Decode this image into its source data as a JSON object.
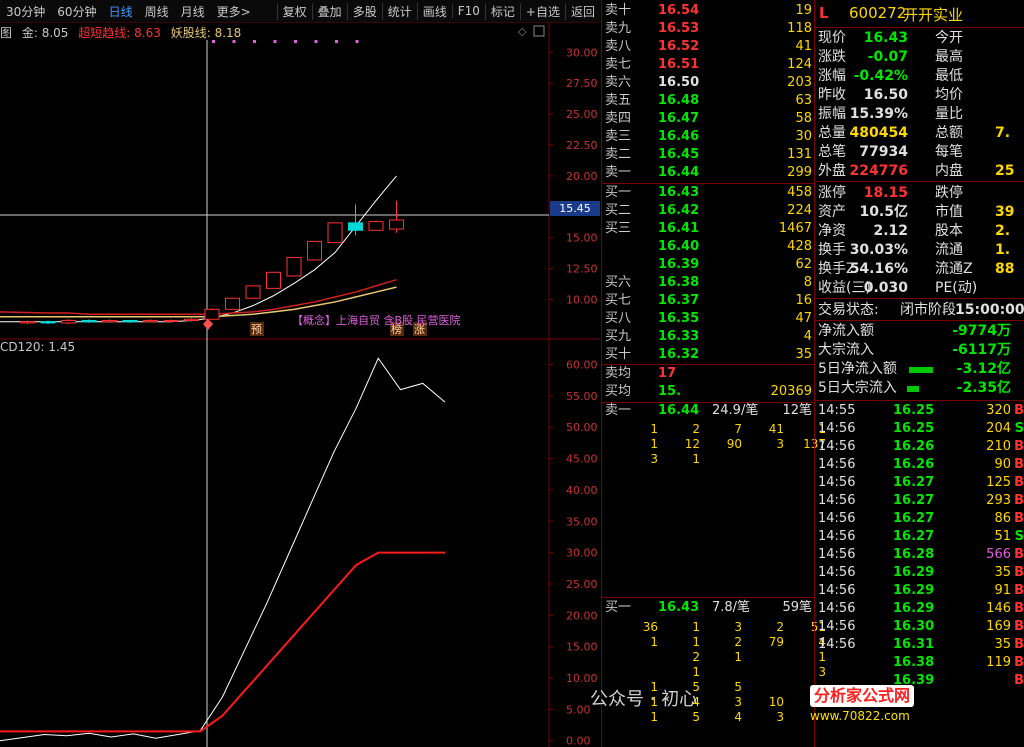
{
  "toolbar": {
    "tabs": [
      "30分钟",
      "60分钟",
      "日线",
      "周线",
      "月线",
      "更多>"
    ],
    "active_tab": "日线",
    "buttons": [
      "复权",
      "叠加",
      "多股",
      "统计",
      "画线",
      "F10",
      "标记",
      "+自选",
      "返回"
    ]
  },
  "indicators": {
    "prefix": "图",
    "gold_label": "金:",
    "gold_value": "8.05",
    "super_label": "超短趋线:",
    "super_value": "8.63",
    "demon_label": "妖股线:",
    "demon_value": "8.18"
  },
  "macd_label": "CD120: 1.45",
  "concept_text": "【概念】上海自贸 含B股 民营医院",
  "markers": [
    "预",
    "榜",
    "涨"
  ],
  "current_price_tag": "15.45",
  "colors": {
    "up": "#ff3232",
    "down": "#00e600",
    "grid": "#7a0000",
    "accent": "#3a9cff"
  },
  "chart_data": [
    {
      "type": "candlestick",
      "y_ticks": [
        "30.00",
        "27.50",
        "25.00",
        "22.50",
        "20.00",
        "17.50",
        "15.00",
        "12.50",
        "10.00"
      ],
      "ylim": [
        8.5,
        31
      ],
      "candles": [
        {
          "o": 8.1,
          "c": 8.2,
          "h": 8.3,
          "l": 8.0
        },
        {
          "o": 8.2,
          "c": 8.1,
          "h": 8.3,
          "l": 8.0
        },
        {
          "o": 8.1,
          "c": 8.3,
          "h": 8.4,
          "l": 8.0
        },
        {
          "o": 8.3,
          "c": 8.2,
          "h": 8.4,
          "l": 8.1
        },
        {
          "o": 8.2,
          "c": 8.3,
          "h": 8.4,
          "l": 8.1
        },
        {
          "o": 8.3,
          "c": 8.2,
          "h": 8.3,
          "l": 8.1
        },
        {
          "o": 8.2,
          "c": 8.3,
          "h": 8.4,
          "l": 8.2
        },
        {
          "o": 8.3,
          "c": 8.3,
          "h": 8.4,
          "l": 8.2
        },
        {
          "o": 8.3,
          "c": 8.4,
          "h": 8.5,
          "l": 8.2
        },
        {
          "o": 8.4,
          "c": 9.2,
          "h": 9.3,
          "l": 8.4
        },
        {
          "o": 9.2,
          "c": 10.1,
          "h": 10.1,
          "l": 9.2
        },
        {
          "o": 10.1,
          "c": 11.1,
          "h": 11.1,
          "l": 10.1
        },
        {
          "o": 10.9,
          "c": 12.2,
          "h": 12.2,
          "l": 10.9
        },
        {
          "o": 11.9,
          "c": 13.4,
          "h": 13.4,
          "l": 11.9
        },
        {
          "o": 13.2,
          "c": 14.7,
          "h": 14.7,
          "l": 13.2
        },
        {
          "o": 14.6,
          "c": 16.2,
          "h": 16.2,
          "l": 14.6
        },
        {
          "o": 16.2,
          "c": 15.6,
          "h": 17.7,
          "l": 15.2
        },
        {
          "o": 15.6,
          "c": 16.3,
          "h": 16.4,
          "l": 15.6
        },
        {
          "o": 15.7,
          "c": 16.43,
          "h": 18.0,
          "l": 15.4
        }
      ],
      "ma": [
        {
          "name": "",
          "color": "#ffffff",
          "values": [
            8.2,
            8.2,
            8.2,
            8.2,
            8.2,
            8.2,
            8.2,
            8.2,
            8.3,
            8.5,
            8.9,
            9.5,
            10.3,
            11.3,
            12.4,
            13.8,
            15.9,
            18.0,
            20.0
          ]
        },
        {
          "name": "",
          "color": "#d02020",
          "values": [
            9.0,
            8.9,
            8.9,
            8.8,
            8.8,
            8.8,
            8.8,
            8.8,
            8.8,
            8.8,
            8.9,
            9.0,
            9.2,
            9.5,
            9.8,
            10.2,
            10.6,
            11.1,
            11.6
          ]
        },
        {
          "name": "",
          "color": "#e8c870",
          "values": [
            8.6,
            8.6,
            8.6,
            8.6,
            8.6,
            8.6,
            8.6,
            8.6,
            8.6,
            8.6,
            8.7,
            8.8,
            9.0,
            9.2,
            9.5,
            9.8,
            10.2,
            10.6,
            11.0
          ]
        }
      ]
    },
    {
      "type": "line",
      "y_ticks": [
        "60.00",
        "55.00",
        "50.00",
        "45.00",
        "40.00",
        "35.00",
        "30.00",
        "25.00",
        "20.00",
        "15.00",
        "10.00",
        "5.00",
        "0.00"
      ],
      "ylim": [
        -1,
        62
      ],
      "series": [
        {
          "name": "",
          "color": "#ffffff",
          "values": [
            0,
            0.5,
            1,
            0.8,
            1.2,
            0.6,
            1.1,
            0.4,
            1,
            1.6,
            7,
            14.5,
            22,
            30,
            38,
            46,
            53,
            61,
            56,
            57,
            54
          ]
        },
        {
          "name": "",
          "color": "#ff1a1a",
          "values": [
            1.5,
            1.5,
            1.5,
            1.5,
            1.5,
            1.5,
            1.5,
            1.5,
            1.5,
            1.5,
            4,
            8,
            12,
            16,
            20,
            24,
            28,
            30,
            30,
            30,
            30
          ]
        }
      ]
    }
  ],
  "order_book": {
    "asks": [
      {
        "label": "卖十",
        "price": "16.54",
        "vol": "19"
      },
      {
        "label": "卖九",
        "price": "16.53",
        "vol": "118"
      },
      {
        "label": "卖八",
        "price": "16.52",
        "vol": "41"
      },
      {
        "label": "卖七",
        "price": "16.51",
        "vol": "124"
      },
      {
        "label": "卖六",
        "price": "16.50",
        "vol": "203"
      },
      {
        "label": "卖五",
        "price": "16.48",
        "vol": "63"
      },
      {
        "label": "卖四",
        "price": "16.47",
        "vol": "58"
      },
      {
        "label": "卖三",
        "price": "16.46",
        "vol": "30"
      },
      {
        "label": "卖二",
        "price": "16.45",
        "vol": "131"
      },
      {
        "label": "卖一",
        "price": "16.44",
        "vol": "299"
      }
    ],
    "bids": [
      {
        "label": "买一",
        "price": "16.43",
        "vol": "458"
      },
      {
        "label": "买二",
        "price": "16.42",
        "vol": "224"
      },
      {
        "label": "买三",
        "price": "16.41",
        "vol": "1467"
      },
      {
        "label": "",
        "price": "16.40",
        "vol": "428"
      },
      {
        "label": "",
        "price": "16.39",
        "vol": "62"
      },
      {
        "label": "买六",
        "price": "16.38",
        "vol": "8"
      },
      {
        "label": "买七",
        "price": "16.37",
        "vol": "16"
      },
      {
        "label": "买八",
        "price": "16.35",
        "vol": "47"
      },
      {
        "label": "买九",
        "price": "16.33",
        "vol": "4"
      },
      {
        "label": "买十",
        "price": "16.32",
        "vol": "35"
      }
    ],
    "avg_ask": {
      "label": "卖均",
      "price": "17",
      "vol": ""
    },
    "avg_bid": {
      "label": "买均",
      "price": "15.",
      "vol": "20369"
    },
    "sell1_summary": {
      "label": "卖一",
      "price": "16.44",
      "mid": "24.9/笔",
      "right": "12笔"
    },
    "sell1_queue": [
      [
        "1",
        "2",
        "7",
        "41",
        "1"
      ],
      [
        "1",
        "12",
        "90",
        "3",
        "137"
      ],
      [
        "3",
        "1",
        "",
        "",
        ""
      ]
    ],
    "buy1_summary": {
      "label": "买一",
      "price": "16.43",
      "mid": "7.8/笔",
      "right": "59笔"
    },
    "buy1_queue": [
      [
        "36",
        "1",
        "3",
        "2",
        "51"
      ],
      [
        "1",
        "1",
        "2",
        "79",
        "4"
      ],
      [
        "",
        "2",
        "1",
        "",
        "1"
      ],
      [
        "",
        "1",
        "",
        "",
        "3"
      ],
      [
        "1",
        "5",
        "5",
        "",
        ""
      ],
      [
        "1",
        "4",
        "3",
        "10",
        ""
      ],
      [
        "1",
        "5",
        "4",
        "3",
        ""
      ]
    ]
  },
  "info": {
    "flag": "L",
    "code": "600272",
    "name": "开开实业",
    "rows": [
      {
        "k": "现价",
        "v": "16.43",
        "vc": "green",
        "k2": "今开",
        "v2": ""
      },
      {
        "k": "涨跌",
        "v": "-0.07",
        "vc": "green",
        "k2": "最高",
        "v2": ""
      },
      {
        "k": "涨幅",
        "v": "-0.42%",
        "vc": "green",
        "k2": "最低",
        "v2": ""
      },
      {
        "k": "昨收",
        "v": "16.50",
        "vc": "white",
        "k2": "均价",
        "v2": ""
      },
      {
        "k": "振幅",
        "v": "15.39%",
        "vc": "white",
        "k2": "量比",
        "v2": ""
      },
      {
        "k": "总量",
        "v": "480454",
        "vc": "yellow",
        "k2": "总额",
        "v2": "7."
      },
      {
        "k": "总笔",
        "v": "77934",
        "vc": "white",
        "k2": "每笔",
        "v2": ""
      },
      {
        "k": "外盘",
        "v": "224776",
        "vc": "red",
        "k2": "内盘",
        "v2": "25"
      },
      {
        "k": "涨停",
        "v": "18.15",
        "vc": "red",
        "k2": "跌停",
        "v2": ""
      },
      {
        "k": "资产",
        "v": "10.5亿",
        "vc": "white",
        "k2": "市值",
        "v2": "39"
      },
      {
        "k": "净资",
        "v": "2.12",
        "vc": "white",
        "k2": "股本",
        "v2": "2."
      },
      {
        "k": "换手",
        "v": "30.03%",
        "vc": "white",
        "k2": "流通",
        "v2": "1."
      },
      {
        "k": "换手Z",
        "v": "54.16%",
        "vc": "white",
        "k2": "流通Z",
        "v2": "88"
      },
      {
        "k": "收益(三)",
        "v": "0.030",
        "vc": "white",
        "k2": "PE(动)",
        "v2": ""
      }
    ],
    "status_label": "交易状态:",
    "status_value": "闭市阶段",
    "status_time": "15:00:00",
    "flows": [
      {
        "k": "净流入额",
        "v": "-9774万"
      },
      {
        "k": "大宗流入",
        "v": "-6117万"
      },
      {
        "k": "5日净流入额",
        "v": "-3.12亿"
      },
      {
        "k": "5日大宗流入",
        "v": "-2.35亿"
      }
    ],
    "ticks": [
      {
        "t": "14:55",
        "p": "16.25",
        "n": "320",
        "bs": "B"
      },
      {
        "t": "14:56",
        "p": "16.25",
        "n": "204",
        "bs": "S"
      },
      {
        "t": "14:56",
        "p": "16.26",
        "n": "210",
        "bs": "B"
      },
      {
        "t": "14:56",
        "p": "16.26",
        "n": "90",
        "bs": "B"
      },
      {
        "t": "14:56",
        "p": "16.27",
        "n": "125",
        "bs": "B"
      },
      {
        "t": "14:56",
        "p": "16.27",
        "n": "293",
        "bs": "B"
      },
      {
        "t": "14:56",
        "p": "16.27",
        "n": "86",
        "bs": "B"
      },
      {
        "t": "14:56",
        "p": "16.27",
        "n": "51",
        "bs": "S"
      },
      {
        "t": "14:56",
        "p": "16.28",
        "n": "566",
        "bs": "B"
      },
      {
        "t": "14:56",
        "p": "16.29",
        "n": "35",
        "bs": "B"
      },
      {
        "t": "14:56",
        "p": "16.29",
        "n": "91",
        "bs": "B"
      },
      {
        "t": "14:56",
        "p": "16.29",
        "n": "146",
        "bs": "B"
      },
      {
        "t": "14:56",
        "p": "16.30",
        "n": "169",
        "bs": "B"
      },
      {
        "t": "14:56",
        "p": "16.31",
        "n": "35",
        "bs": "B"
      },
      {
        "t": "",
        "p": "16.38",
        "n": "119",
        "bs": "B"
      },
      {
        "t": "",
        "p": "16.39",
        "n": "",
        "bs": "B"
      }
    ]
  },
  "watermark": {
    "wechat": "公众号 · 初心",
    "logo_text": "分析家公式网",
    "logo_url": "www.70822.com"
  }
}
